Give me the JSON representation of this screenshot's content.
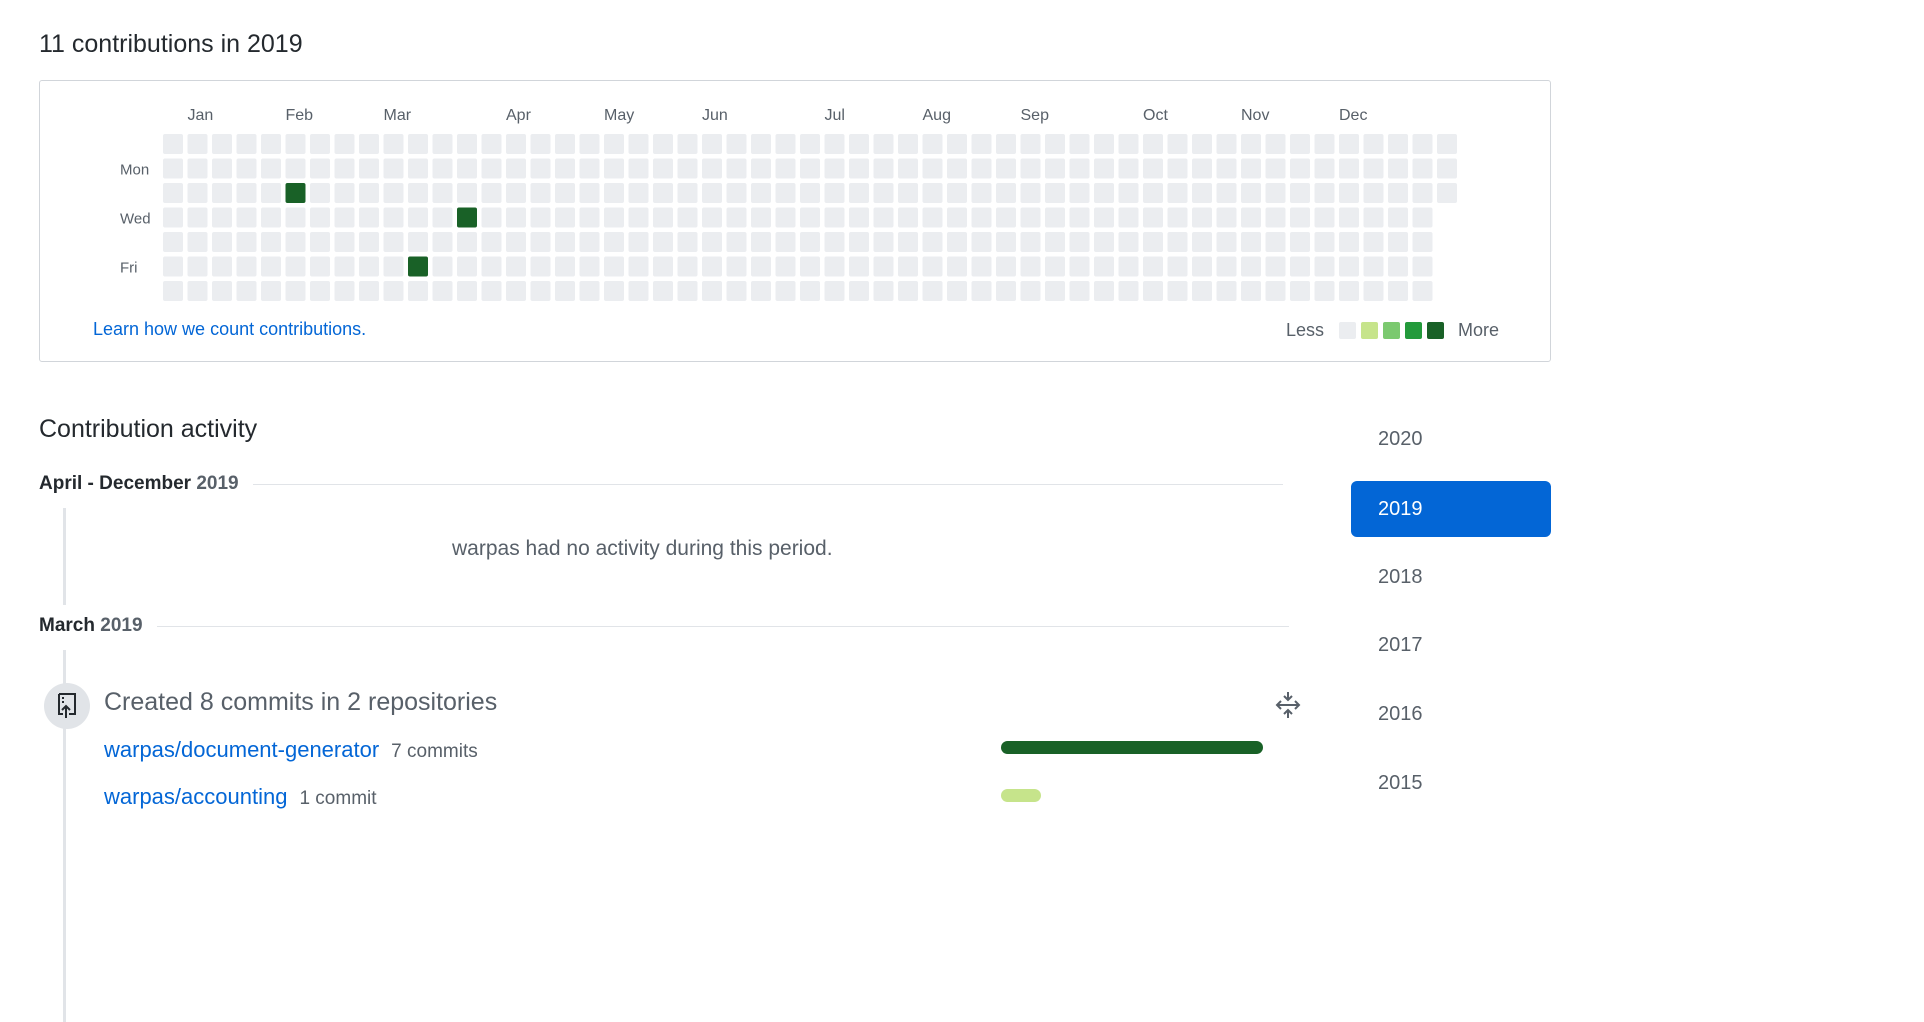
{
  "contributions": {
    "heading": "11 contributions in 2019",
    "months": [
      "Jan",
      "Feb",
      "Mar",
      "Apr",
      "May",
      "Jun",
      "Jul",
      "Aug",
      "Sep",
      "Oct",
      "Nov",
      "Dec"
    ],
    "month_week_index": [
      1,
      5,
      9,
      14,
      18,
      22,
      27,
      31,
      35,
      40,
      44,
      48
    ],
    "day_labels": [
      {
        "label": "Mon",
        "row": 1
      },
      {
        "label": "Wed",
        "row": 3
      },
      {
        "label": "Fri",
        "row": 5
      }
    ],
    "weeks": 53,
    "first_week_start_row": 0,
    "last_week_rows": 3,
    "active_cells": [
      {
        "week": 5,
        "row": 2,
        "level": 4
      },
      {
        "week": 10,
        "row": 5,
        "level": 4
      },
      {
        "week": 12,
        "row": 3,
        "level": 4
      }
    ],
    "learn_link": "Learn how we count contributions.",
    "legend": {
      "less": "Less",
      "more": "More",
      "colors": [
        "#ebedf0",
        "#c6e48b",
        "#7bc96f",
        "#239a3b",
        "#196127"
      ]
    }
  },
  "activity": {
    "heading": "Contribution activity",
    "periods": [
      {
        "label": "April - December",
        "year": "2019",
        "empty_text": "warpas had no activity during this period."
      },
      {
        "label": "March",
        "year": "2019"
      }
    ],
    "commits": {
      "summary": "Created 8 commits in 2 repositories",
      "repos": [
        {
          "name": "warpas/document-generator",
          "count": "7 commits",
          "value": 7,
          "color": "#196127"
        },
        {
          "name": "warpas/accounting",
          "count": "1 commit",
          "value": 1,
          "color": "#c6e48b"
        }
      ]
    }
  },
  "years": {
    "items": [
      "2020",
      "2019",
      "2018",
      "2017",
      "2016",
      "2015"
    ],
    "selected": "2019"
  },
  "colors": {
    "link": "#0366d6",
    "selected_bg": "#0366d6",
    "empty_cell": "#ebedf0"
  }
}
